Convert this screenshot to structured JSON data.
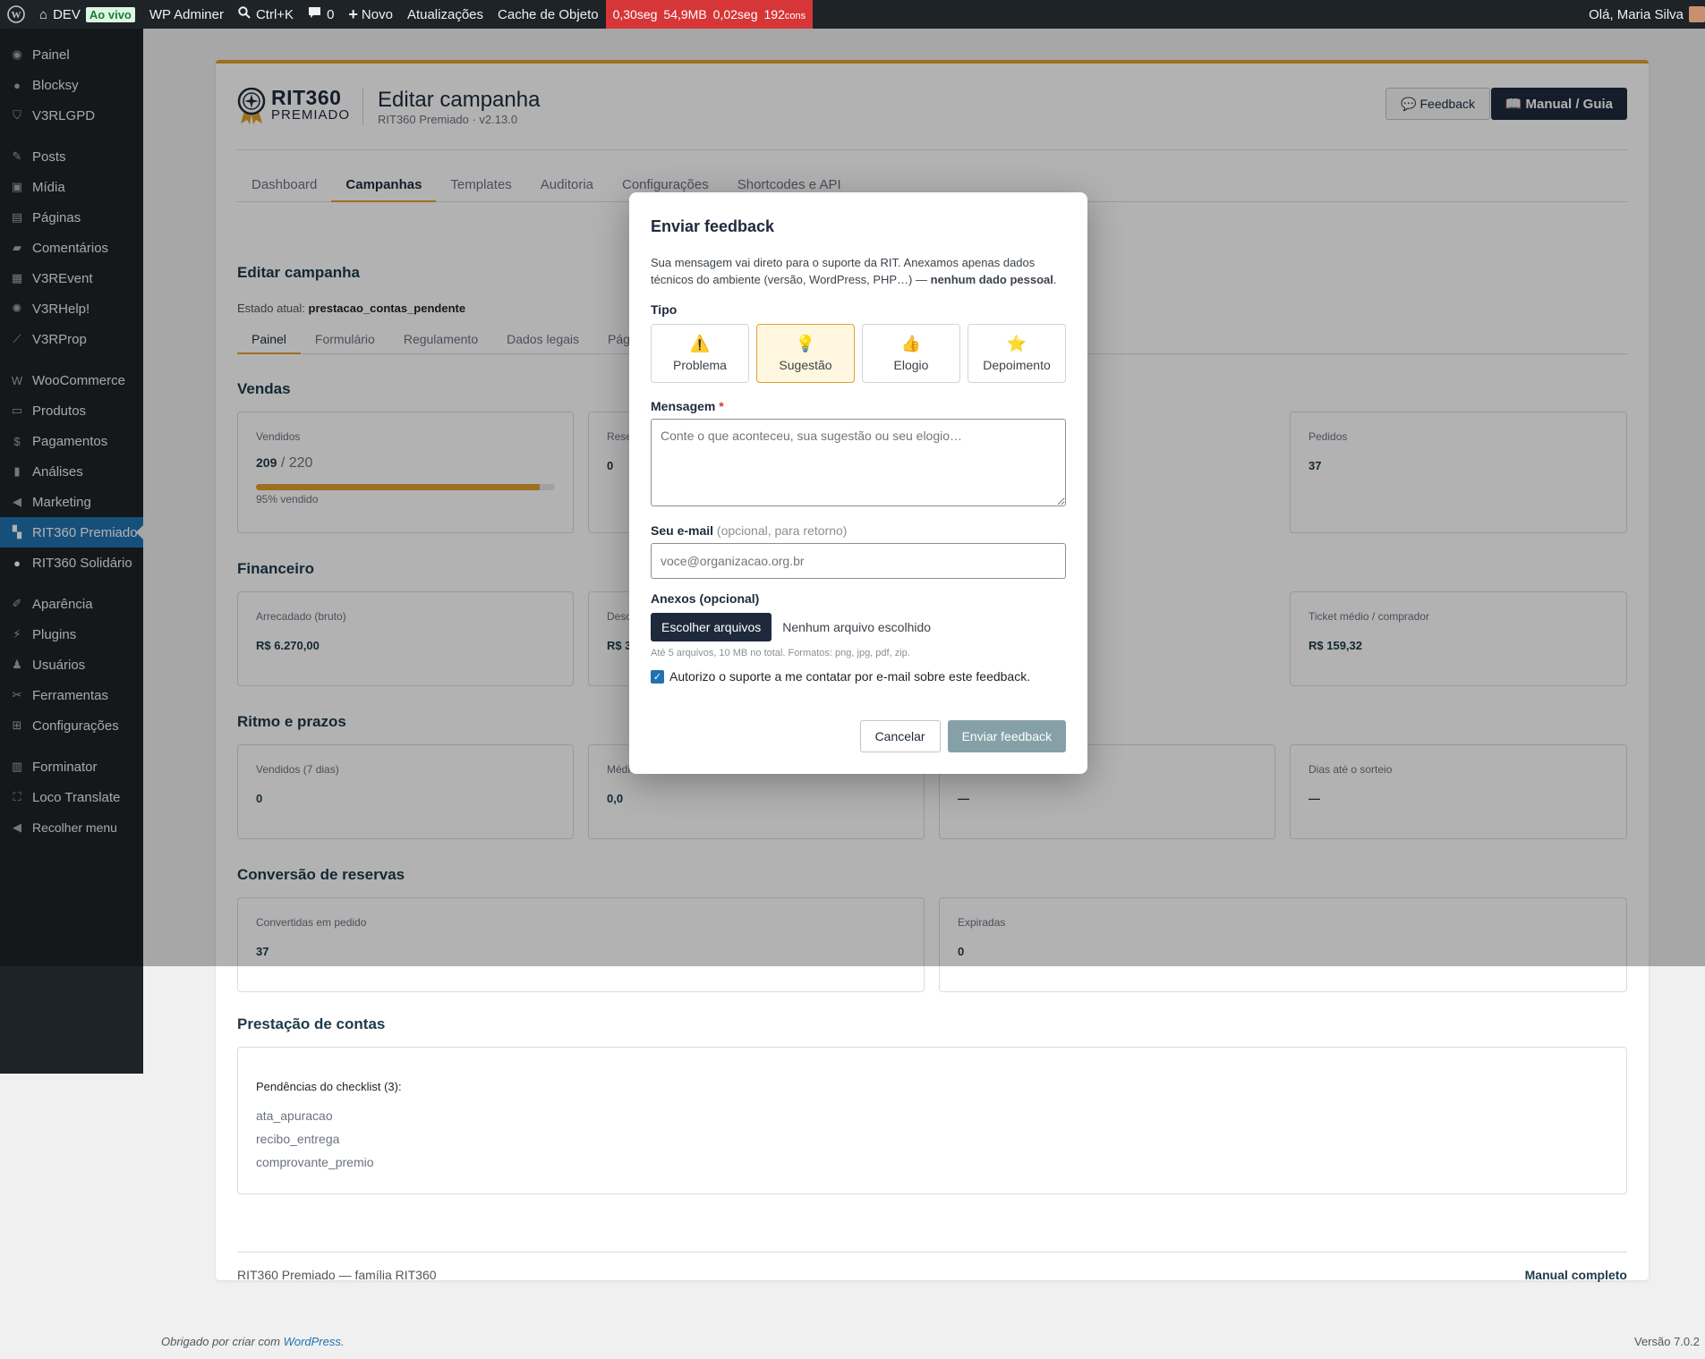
{
  "adminbar": {
    "site": "DEV",
    "live": "Ao vivo",
    "adminer": "WP Adminer",
    "search": "Ctrl+K",
    "comments": "0",
    "new": "Novo",
    "updates": "Atualizações",
    "cache": "Cache de Objeto",
    "perf": {
      "time": "0,30seg",
      "mem": "54,9MB",
      "qtime": "0,02seg",
      "queries": "192",
      "queries_unit": "cons"
    },
    "greeting": "Olá, Maria Silva"
  },
  "sidebar": {
    "items": [
      {
        "label": "Painel",
        "icon": "dashboard-icon"
      },
      {
        "label": "Blocksy",
        "icon": "blocksy-icon"
      },
      {
        "label": "V3RLGPD",
        "icon": "shield-icon"
      },
      {
        "label": "Posts",
        "icon": "pin-icon"
      },
      {
        "label": "Mídia",
        "icon": "media-icon"
      },
      {
        "label": "Páginas",
        "icon": "pages-icon"
      },
      {
        "label": "Comentários",
        "icon": "comment-icon"
      },
      {
        "label": "V3REvent",
        "icon": "calendar-icon"
      },
      {
        "label": "V3RHelp!",
        "icon": "help-icon"
      },
      {
        "label": "V3RProp",
        "icon": "chart-icon"
      },
      {
        "label": "WooCommerce",
        "icon": "woo-icon"
      },
      {
        "label": "Produtos",
        "icon": "archive-icon"
      },
      {
        "label": "Pagamentos",
        "icon": "dollar-icon"
      },
      {
        "label": "Análises",
        "icon": "bar-chart-icon"
      },
      {
        "label": "Marketing",
        "icon": "megaphone-icon"
      },
      {
        "label": "RIT360 Premiado",
        "icon": "ticket-icon"
      },
      {
        "label": "RIT360 Solidário",
        "icon": "circle-icon"
      },
      {
        "label": "Aparência",
        "icon": "brush-icon"
      },
      {
        "label": "Plugins",
        "icon": "plugin-icon"
      },
      {
        "label": "Usuários",
        "icon": "user-icon"
      },
      {
        "label": "Ferramentas",
        "icon": "wrench-icon"
      },
      {
        "label": "Configurações",
        "icon": "settings-icon"
      },
      {
        "label": "Forminator",
        "icon": "form-icon"
      },
      {
        "label": "Loco Translate",
        "icon": "translate-icon"
      },
      {
        "label": "Recolher menu",
        "icon": "collapse-icon"
      }
    ]
  },
  "header": {
    "logo_main": "RIT360",
    "logo_sub": "PREMIADO",
    "title": "Editar campanha",
    "subtitle": "RIT360 Premiado · v2.13.0",
    "feedback_btn": "💬 Feedback",
    "manual_btn": "📖 Manual / Guia"
  },
  "tabs": [
    "Dashboard",
    "Campanhas",
    "Templates",
    "Auditoria",
    "Configurações",
    "Shortcodes e API"
  ],
  "page": {
    "heading": "Editar campanha",
    "estado_label": "Estado atual:",
    "estado_value": "prestacao_contas_pendente"
  },
  "subtabs": [
    "Painel",
    "Formulário",
    "Regulamento",
    "Dados legais",
    "Pág"
  ],
  "sections": {
    "vendas": "Vendas",
    "financeiro": "Financeiro",
    "ritmo": "Ritmo e prazos",
    "conversao": "Conversão de reservas",
    "prestacao": "Prestação de contas"
  },
  "vendas": {
    "vendidos_label": "Vendidos",
    "vendidos_value": "209",
    "vendidos_total": "/ 220",
    "progress_fraction": 0.95,
    "progress_note": "95% vendido",
    "reservas_label": "Rese",
    "reservas_value": "0",
    "pedidos_label": "Pedidos",
    "pedidos_value": "37"
  },
  "financeiro": {
    "arrecadado_label": "Arrecadado (bruto)",
    "arrecadado_value": "R$ 6.270,00",
    "desc_label": "Desc",
    "desc_value": "R$ 3",
    "ticket_label": "Ticket médio / comprador",
    "ticket_value": "R$ 159,32"
  },
  "ritmo": {
    "vendidos7_label": "Vendidos (7 dias)",
    "vendidos7_value": "0",
    "media_label": "Médi",
    "media_value": "0,0",
    "third_value": "—",
    "dias_label": "Dias até o sorteio",
    "dias_value": "—"
  },
  "conversao": {
    "convertidas_label": "Convertidas em pedido",
    "convertidas_value": "37",
    "expiradas_label": "Expiradas",
    "expiradas_value": "0"
  },
  "prestacao": {
    "pendencias_label": "Pendências do checklist (3):",
    "items": [
      "ata_apuracao",
      "recibo_entrega",
      "comprovante_premio"
    ]
  },
  "footer": {
    "left": "RIT360 Premiado — família RIT360",
    "right": "Manual completo",
    "wp_thanks": "Obrigado por criar com",
    "wp_link": "WordPress",
    "version": "Versão 7.0.2"
  },
  "modal": {
    "title": "Enviar feedback",
    "intro": "Sua mensagem vai direto para o suporte da RIT. Anexamos apenas dados técnicos do ambiente (versão, WordPress, PHP…) —",
    "intro_bold": "nenhum dado pessoal",
    "tipo_label": "Tipo",
    "types": [
      {
        "emoji": "⚠️",
        "label": "Problema"
      },
      {
        "emoji": "💡",
        "label": "Sugestão"
      },
      {
        "emoji": "👍",
        "label": "Elogio"
      },
      {
        "emoji": "⭐",
        "label": "Depoimento"
      }
    ],
    "selected_type": "Sugestão",
    "mensagem_label": "Mensagem",
    "mensagem_required": "*",
    "mensagem_placeholder": "Conte o que aconteceu, sua sugestão ou seu elogio…",
    "email_label": "Seu e-mail",
    "email_hint": "(opcional, para retorno)",
    "email_placeholder": "voce@organizacao.org.br",
    "anexos_label": "Anexos (opcional)",
    "file_btn": "Escolher arquivos",
    "file_status": "Nenhum arquivo escolhido",
    "file_hint": "Até 5 arquivos, 10 MB no total. Formatos: png, jpg, pdf, zip.",
    "consent": "Autorizo o suporte a me contatar por e-mail sobre este feedback.",
    "consent_checked": true,
    "cancel": "Cancelar",
    "send": "Enviar feedback"
  },
  "colors": {
    "accent": "#e0a12f",
    "navy": "#1e2a3b",
    "wp_blue": "#2271b1",
    "perf_red": "#d63638"
  }
}
